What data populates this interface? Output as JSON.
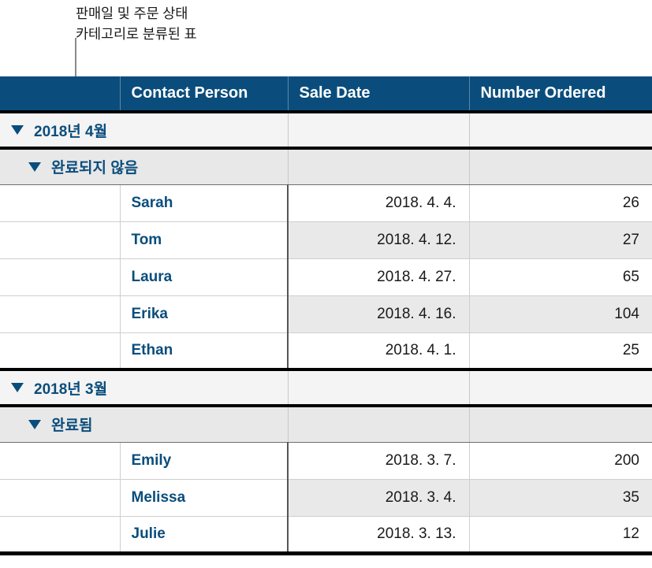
{
  "callout": {
    "lines": [
      "판매일 및 주문 상태",
      "카테고리로 분류된 표"
    ]
  },
  "table": {
    "columns": [
      {
        "key": "handle",
        "label": ""
      },
      {
        "key": "name",
        "label": "Contact Person"
      },
      {
        "key": "date",
        "label": "Sale Date"
      },
      {
        "key": "num",
        "label": "Number Ordered"
      }
    ],
    "disclosure_icon": "triangle-down-icon",
    "accent_color": "#0a4d7c",
    "header_background": "#0a4d7c",
    "header_text_color": "#ffffff",
    "banded_row_color": "#e9e9e9",
    "group_level1_background": "#f4f4f4",
    "group_level2_background": "#e8e8e8",
    "sections": [
      {
        "group_label": "2018년 4월",
        "subgroup_label": "완료되지 않음",
        "rows": [
          {
            "name": "Sarah",
            "date": "2018. 4. 4.",
            "num": "26"
          },
          {
            "name": "Tom",
            "date": "2018. 4. 12.",
            "num": "27"
          },
          {
            "name": "Laura",
            "date": "2018. 4. 27.",
            "num": "65"
          },
          {
            "name": "Erika",
            "date": "2018. 4. 16.",
            "num": "104"
          },
          {
            "name": "Ethan",
            "date": "2018. 4. 1.",
            "num": "25"
          }
        ]
      },
      {
        "group_label": "2018년 3월",
        "subgroup_label": "완료됨",
        "rows": [
          {
            "name": "Emily",
            "date": "2018. 3. 7.",
            "num": "200"
          },
          {
            "name": "Melissa",
            "date": "2018. 3. 4.",
            "num": "35"
          },
          {
            "name": "Julie",
            "date": "2018. 3. 13.",
            "num": "12"
          }
        ]
      }
    ]
  }
}
